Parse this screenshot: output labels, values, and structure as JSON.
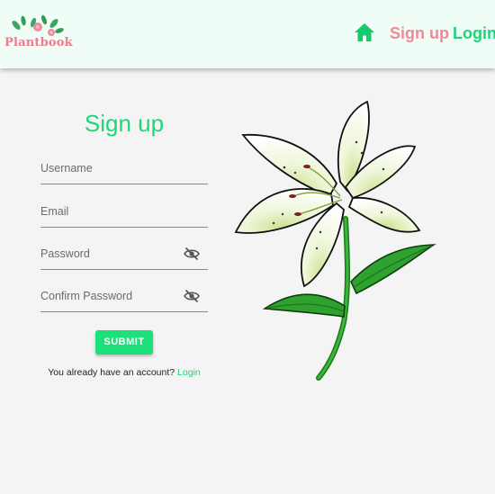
{
  "brand": {
    "name": "Plantbook"
  },
  "nav": {
    "home_icon": "home-icon",
    "signup_label": "Sign up",
    "login_label": "Login"
  },
  "form": {
    "title": "Sign up",
    "fields": [
      {
        "label": "Username",
        "value": ""
      },
      {
        "label": "Email",
        "value": ""
      },
      {
        "label": "Password",
        "value": "",
        "icon": "eye-off-icon"
      },
      {
        "label": "Confirm Password",
        "value": "",
        "icon": "eye-off-icon"
      }
    ],
    "submit_label": "SUBMIT",
    "account_prompt": "You already have an account?",
    "account_login_label": "Login"
  },
  "illustration": {
    "icon": "lily-flower-illustration"
  },
  "colors": {
    "accent_green": "#1ed877",
    "brand_pink": "#ef7b8e",
    "header_bg": "#f0fcf6",
    "page_bg": "#f4f4f4"
  }
}
